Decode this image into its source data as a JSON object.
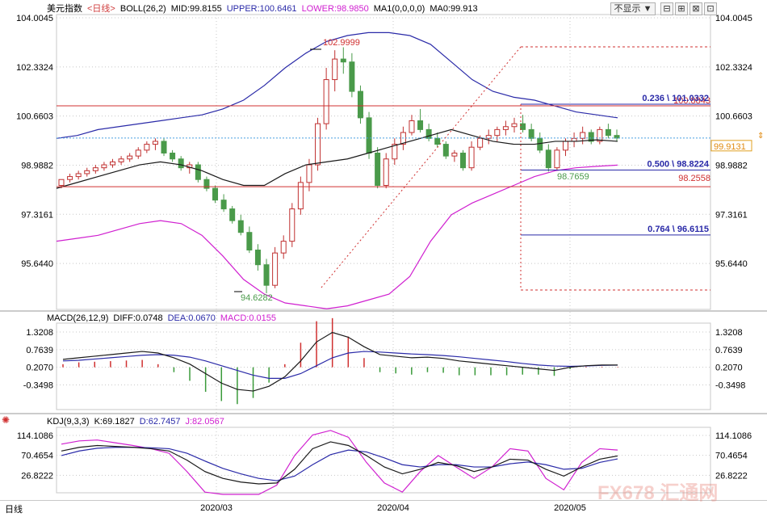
{
  "window": {
    "symbol": "美元指数",
    "period_link": "<日线>",
    "indicator": "BOLL(26,2)",
    "mid": "MID:99.8155",
    "upper": "UPPER:100.6461",
    "lower": "LOWER:98.9850",
    "ma_label": "MA1(0,0,0,0)",
    "ma_value": "MA0:99.913",
    "hide_button": "不显示 ▼",
    "win_buttons": [
      "⊟",
      "⊞",
      "⊠",
      "⊡"
    ],
    "period_tab": "日线",
    "watermark": "FX678 汇通网"
  },
  "colors": {
    "up": "#c03030",
    "down": "#4a9a4a",
    "upper_band": "#2a2aa8",
    "lower_band": "#d020d0",
    "mid_band": "#1a1a1a",
    "dea": "#2a2aa8",
    "macd_pos": "#d03030",
    "macd_neg": "#3a9a3a",
    "k_line": "#1a1a1a",
    "d_line": "#2a2aa8",
    "j_line": "#d020d0",
    "grid": "#c8c8c8"
  },
  "chart_data": [
    {
      "type": "candlestick",
      "title": "美元指数 BOLL(26,2)",
      "yticks": [
        "104.0045",
        "102.3324",
        "100.6603",
        "98.9882",
        "97.3161",
        "95.6440"
      ],
      "ylim": [
        94.3,
        104.0045
      ],
      "xticks": [
        "2020/03",
        "2020/04",
        "2020/05"
      ],
      "last_price": "99.9131",
      "annotations": {
        "high": "102.9999",
        "low": "94.6282",
        "recent_low": "98.7659",
        "support": "98.2558",
        "resistance": "100.8843",
        "fib_236": "0.236 \\ 101.0332",
        "fib_500": "0.500 \\ 98.8224",
        "fib_764": "0.764 \\ 96.6115"
      },
      "candles": [
        [
          98.3,
          98.5,
          98.2,
          98.5
        ],
        [
          98.5,
          98.7,
          98.4,
          98.6
        ],
        [
          98.6,
          98.8,
          98.5,
          98.7
        ],
        [
          98.7,
          98.9,
          98.6,
          98.8
        ],
        [
          98.8,
          99.0,
          98.7,
          98.9
        ],
        [
          98.9,
          99.1,
          98.8,
          99.0
        ],
        [
          99.0,
          99.2,
          98.9,
          99.1
        ],
        [
          99.1,
          99.3,
          99.0,
          99.2
        ],
        [
          99.2,
          99.4,
          99.1,
          99.3
        ],
        [
          99.3,
          99.6,
          99.2,
          99.5
        ],
        [
          99.5,
          99.8,
          99.4,
          99.7
        ],
        [
          99.7,
          99.9,
          99.5,
          99.8
        ],
        [
          99.8,
          99.9,
          99.3,
          99.4
        ],
        [
          99.4,
          99.5,
          99.1,
          99.2
        ],
        [
          99.2,
          99.3,
          98.8,
          98.9
        ],
        [
          98.9,
          99.1,
          98.7,
          99.0
        ],
        [
          99.0,
          99.1,
          98.4,
          98.5
        ],
        [
          98.5,
          98.6,
          98.1,
          98.2
        ],
        [
          98.2,
          98.3,
          97.7,
          97.8
        ],
        [
          97.8,
          98.0,
          97.4,
          97.5
        ],
        [
          97.5,
          97.6,
          97.0,
          97.1
        ],
        [
          97.1,
          97.3,
          96.6,
          96.7
        ],
        [
          96.7,
          96.9,
          96.0,
          96.1
        ],
        [
          96.1,
          96.3,
          95.4,
          95.6
        ],
        [
          95.6,
          95.8,
          94.63,
          94.9
        ],
        [
          94.9,
          96.2,
          94.8,
          96.0
        ],
        [
          96.0,
          96.6,
          95.8,
          96.4
        ],
        [
          96.4,
          97.7,
          96.2,
          97.5
        ],
        [
          97.5,
          98.6,
          97.3,
          98.4
        ],
        [
          98.4,
          99.2,
          98.1,
          99.0
        ],
        [
          99.0,
          100.6,
          98.8,
          100.4
        ],
        [
          100.4,
          102.3,
          100.2,
          101.9
        ],
        [
          101.9,
          102.9,
          101.5,
          102.6
        ],
        [
          102.6,
          103.0,
          102.1,
          102.5
        ],
        [
          102.5,
          102.8,
          101.3,
          101.5
        ],
        [
          101.5,
          101.7,
          100.4,
          100.6
        ],
        [
          100.6,
          100.8,
          99.2,
          99.4
        ],
        [
          99.4,
          99.6,
          98.2,
          98.3
        ],
        [
          98.3,
          99.4,
          98.2,
          99.2
        ],
        [
          99.2,
          99.9,
          99.0,
          99.7
        ],
        [
          99.7,
          100.3,
          99.5,
          100.1
        ],
        [
          100.1,
          100.7,
          100.0,
          100.5
        ],
        [
          100.5,
          100.9,
          100.1,
          100.2
        ],
        [
          100.2,
          100.4,
          99.8,
          99.9
        ],
        [
          99.9,
          100.1,
          99.6,
          99.7
        ],
        [
          99.7,
          99.8,
          99.2,
          99.3
        ],
        [
          99.3,
          99.5,
          99.1,
          99.4
        ],
        [
          99.4,
          99.5,
          98.8,
          98.9
        ],
        [
          98.9,
          99.8,
          98.8,
          99.6
        ],
        [
          99.6,
          100.0,
          99.5,
          99.9
        ],
        [
          99.9,
          100.2,
          99.7,
          100.0
        ],
        [
          100.0,
          100.3,
          99.8,
          100.2
        ],
        [
          100.2,
          100.5,
          100.0,
          100.3
        ],
        [
          100.3,
          100.6,
          100.1,
          100.4
        ],
        [
          100.4,
          100.7,
          100.1,
          100.2
        ],
        [
          100.2,
          100.4,
          99.8,
          99.9
        ],
        [
          99.9,
          100.1,
          99.4,
          99.5
        ],
        [
          99.5,
          99.7,
          98.77,
          98.9
        ],
        [
          98.9,
          99.6,
          98.8,
          99.5
        ],
        [
          99.5,
          99.9,
          99.3,
          99.8
        ],
        [
          99.8,
          100.1,
          99.6,
          99.9
        ],
        [
          99.9,
          100.3,
          99.7,
          100.1
        ],
        [
          100.1,
          100.2,
          99.7,
          99.8
        ],
        [
          99.8,
          100.3,
          99.7,
          100.2
        ],
        [
          100.2,
          100.4,
          99.9,
          100.0
        ],
        [
          100.0,
          100.2,
          99.8,
          99.91
        ]
      ],
      "upper_band": [
        99.9,
        100.0,
        100.2,
        100.3,
        100.4,
        100.5,
        100.6,
        100.7,
        100.9,
        101.2,
        101.7,
        102.3,
        102.8,
        103.2,
        103.4,
        103.5,
        103.5,
        103.4,
        103.1,
        102.5,
        101.9,
        101.5,
        101.3,
        101.2,
        101.0,
        100.8,
        100.7,
        100.6
      ],
      "lower_band": [
        96.4,
        96.5,
        96.6,
        96.8,
        97.0,
        97.1,
        97.0,
        96.6,
        95.9,
        95.1,
        94.6,
        94.3,
        94.2,
        94.1,
        94.2,
        94.4,
        94.6,
        95.2,
        96.4,
        97.3,
        97.7,
        98.0,
        98.3,
        98.6,
        98.8,
        98.9,
        98.95,
        98.99
      ],
      "mid_band": [
        98.2,
        98.4,
        98.6,
        98.8,
        99.0,
        99.1,
        99.0,
        98.8,
        98.5,
        98.3,
        98.3,
        98.7,
        99.0,
        99.1,
        99.2,
        99.4,
        99.6,
        99.8,
        100.0,
        100.2,
        100.0,
        99.8,
        99.7,
        99.7,
        99.8,
        99.8,
        99.85,
        99.8
      ]
    },
    {
      "type": "bar",
      "title": "MACD(26,12,9)",
      "diff_label": "DIFF:0.0748",
      "dea_label": "DEA:0.0670",
      "macd_label": "MACD:0.0155",
      "yticks": [
        "1.3208",
        "0.7639",
        "0.2070",
        "-0.3498"
      ],
      "ylim": [
        -0.95,
        1.55
      ],
      "diff": [
        0.25,
        0.3,
        0.35,
        0.4,
        0.45,
        0.5,
        0.45,
        0.3,
        0.1,
        -0.2,
        -0.5,
        -0.7,
        -0.75,
        -0.6,
        -0.3,
        0.2,
        0.8,
        1.1,
        0.95,
        0.65,
        0.4,
        0.35,
        0.3,
        0.32,
        0.28,
        0.2,
        0.15,
        0.1,
        0.05,
        0.0,
        -0.05,
        -0.1,
        0.0,
        0.05,
        0.07,
        0.07
      ],
      "dea": [
        0.2,
        0.22,
        0.26,
        0.3,
        0.34,
        0.38,
        0.4,
        0.38,
        0.32,
        0.2,
        0.05,
        -0.1,
        -0.25,
        -0.35,
        -0.35,
        -0.2,
        0.05,
        0.3,
        0.45,
        0.5,
        0.48,
        0.45,
        0.42,
        0.4,
        0.37,
        0.33,
        0.28,
        0.23,
        0.18,
        0.12,
        0.07,
        0.04,
        0.03,
        0.04,
        0.06,
        0.067
      ],
      "macd": [
        0.1,
        0.16,
        0.18,
        0.2,
        0.22,
        0.24,
        0.1,
        -0.16,
        -0.44,
        -0.8,
        -1.1,
        -1.2,
        -1.0,
        -0.5,
        0.1,
        0.8,
        1.5,
        1.6,
        1.0,
        0.3,
        -0.16,
        -0.2,
        -0.24,
        -0.16,
        -0.18,
        -0.26,
        -0.26,
        -0.26,
        -0.26,
        -0.24,
        -0.24,
        -0.28,
        -0.06,
        0.02,
        0.02,
        0.0155
      ]
    },
    {
      "type": "line",
      "title": "KDJ(9,3,3)",
      "k_label": "K:69.1827",
      "d_label": "D:62.7457",
      "j_label": "J:82.0567",
      "yticks": [
        "114.1086",
        "70.4654",
        "26.8222"
      ],
      "ylim": [
        -15,
        130
      ],
      "k": [
        80,
        88,
        92,
        90,
        88,
        85,
        80,
        60,
        35,
        20,
        12,
        8,
        10,
        40,
        85,
        100,
        92,
        70,
        45,
        30,
        40,
        55,
        48,
        35,
        45,
        62,
        60,
        40,
        25,
        45,
        62,
        69.18
      ],
      "d": [
        70,
        80,
        86,
        88,
        88,
        87,
        85,
        75,
        58,
        42,
        30,
        20,
        15,
        25,
        50,
        72,
        82,
        78,
        65,
        50,
        45,
        50,
        50,
        45,
        45,
        52,
        56,
        50,
        40,
        42,
        55,
        62.75
      ],
      "j": [
        95,
        102,
        104,
        98,
        92,
        85,
        75,
        35,
        -10,
        -22,
        -18,
        -15,
        5,
        70,
        115,
        125,
        110,
        55,
        10,
        -10,
        35,
        70,
        45,
        20,
        45,
        85,
        80,
        20,
        -5,
        55,
        85,
        82.06
      ]
    }
  ]
}
